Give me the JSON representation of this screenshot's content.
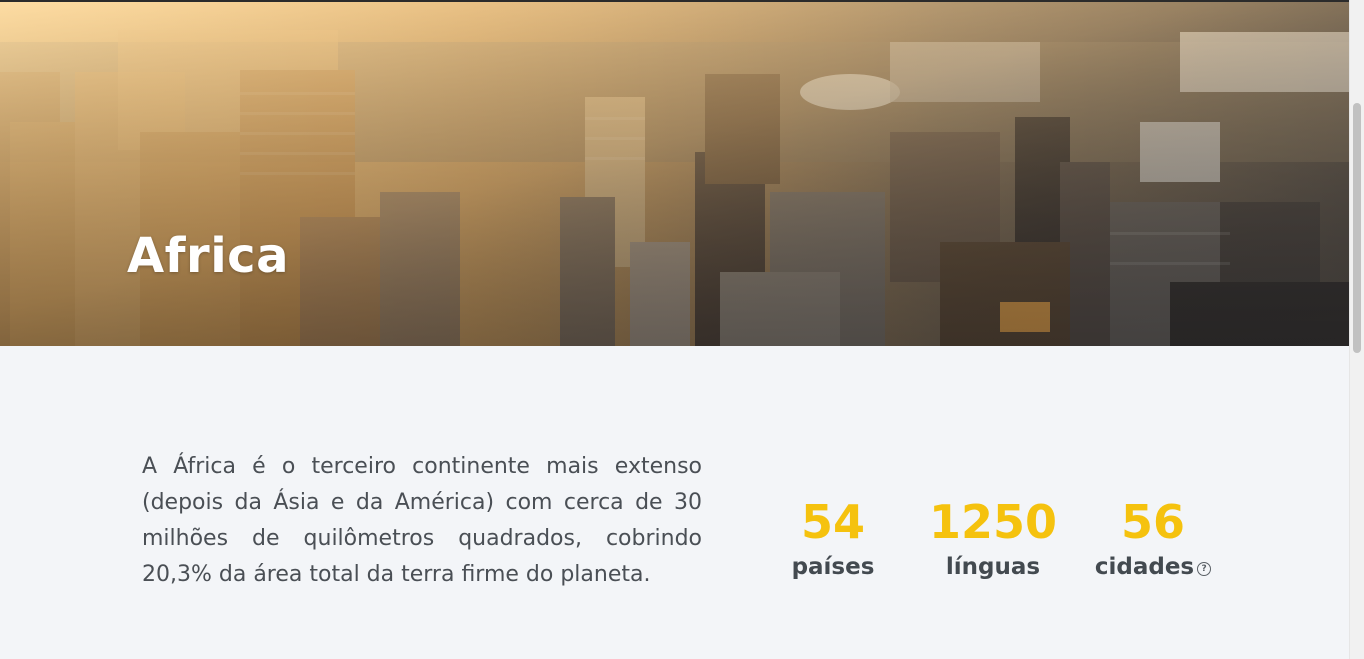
{
  "hero": {
    "title": "Africa",
    "image_alt": "aerial city skyline"
  },
  "description": "A África é o terceiro continente mais extenso (depois da Ásia e da América) com cerca de 30 milhões de quilômetros quadrados, cobrindo 20,3% da área total da terra firme do planeta.",
  "stats": [
    {
      "value": "54",
      "label": "países"
    },
    {
      "value": "1250",
      "label": "línguas"
    },
    {
      "value": "56",
      "label": "cidades",
      "icon": "help-icon"
    }
  ],
  "colors": {
    "accent": "#f5c20e",
    "text": "#4a4f55",
    "background": "#f3f5f8"
  }
}
